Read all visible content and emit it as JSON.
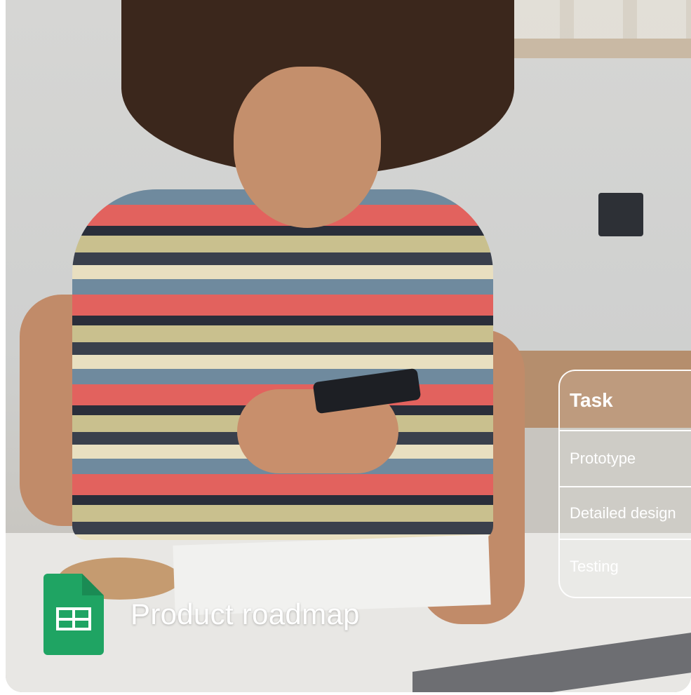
{
  "task_table": {
    "header": "Task",
    "rows": [
      "Prototype",
      "Detailed design",
      "Testing"
    ]
  },
  "file": {
    "name": "Product roadmap",
    "icon": "google-sheets-icon"
  },
  "colors": {
    "sheets_green": "#1fa463",
    "overlay_text": "#ffffff"
  }
}
